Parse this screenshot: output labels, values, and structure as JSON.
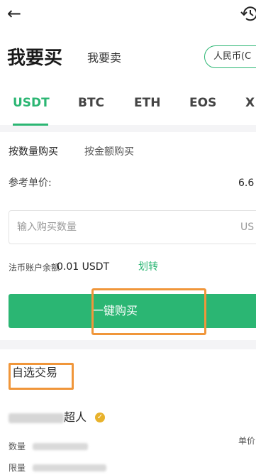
{
  "header": {
    "back_icon": "arrow-left-icon",
    "history_icon": "history-clock-icon",
    "title_buy": "我要买",
    "title_sell": "我要卖",
    "currency_label": "人民币(C"
  },
  "coin_tabs": [
    {
      "label": "USDT",
      "active": true
    },
    {
      "label": "BTC",
      "active": false
    },
    {
      "label": "ETH",
      "active": false
    },
    {
      "label": "EOS",
      "active": false
    },
    {
      "label": "X",
      "active": false
    }
  ],
  "trade": {
    "mode_quantity": "按数量购买",
    "mode_amount": "按金额购买",
    "ref_price_label": "参考单价:",
    "ref_price_value": "6.6",
    "qty_placeholder": "输入购买数量",
    "qty_unit": "US",
    "balance_label": "法币账户余额",
    "balance_value": "0.01 USDT",
    "transfer_label": "划转",
    "buy_button": "一键购买"
  },
  "self_select": {
    "label": "自选交易",
    "merchant_suffix": "超人",
    "unit_header": "单价",
    "rows": [
      {
        "label": "数量"
      },
      {
        "label": "限量"
      }
    ]
  },
  "colors": {
    "accent": "#2bb673",
    "highlight": "#f0963a"
  }
}
